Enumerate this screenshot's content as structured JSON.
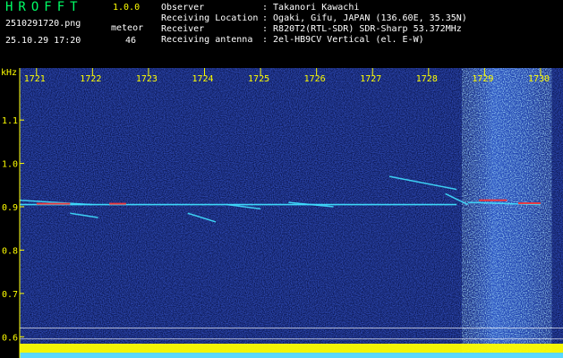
{
  "header": {
    "logo": "HROFFT",
    "version": "1.0.0",
    "filename": "2510291720.png",
    "datetime": "25.10.29 17:20",
    "meteor_label": "meteor",
    "meteor_count": "46",
    "info": [
      {
        "label": "Observer",
        "value": ": Takanori Kawachi"
      },
      {
        "label": "Receiving Location",
        "value": ": Ogaki, Gifu, JAPAN (136.60E, 35.35N)"
      },
      {
        "label": "Receiver",
        "value": ": R820T2(RTL-SDR) SDR-Sharp 53.372MHz"
      },
      {
        "label": "Receiving antenna",
        "value": ": 2el-HB9CV Vertical (el. E-W)"
      }
    ]
  },
  "colors": {
    "background_noise": "#0a1a6e",
    "signal_cyan": "#40e0ff",
    "signal_red": "#ff3030",
    "label_yellow": "#ffff00",
    "header_green": "#00ff66",
    "amplitude_bar": "#ffff00"
  },
  "chart_data": {
    "type": "heatmap",
    "ylabel": "kHz",
    "xlim": [
      1720.7,
      1730.4
    ],
    "ylim": [
      0.58,
      1.22
    ],
    "x_ticks": [
      "1721",
      "1722",
      "1723",
      "1724",
      "1725",
      "1726",
      "1727",
      "1728",
      "1729",
      "1730"
    ],
    "y_ticks": [
      "1.1",
      "1.0",
      "0.9",
      "0.8",
      "0.7",
      "0.6"
    ],
    "y_tick_values": [
      1.1,
      1.0,
      0.9,
      0.8,
      0.7,
      0.6
    ],
    "continuous_carrier": {
      "y": 0.905,
      "x": [
        1720.7,
        1728.5
      ]
    },
    "meteor_echoes": [
      {
        "x": [
          1720.7,
          1722.0
        ],
        "y": [
          0.915,
          0.905
        ]
      },
      {
        "x": [
          1721.6,
          1722.1
        ],
        "y": [
          0.885,
          0.875
        ]
      },
      {
        "x": [
          1723.7,
          1724.2
        ],
        "y": [
          0.885,
          0.865
        ]
      },
      {
        "x": [
          1724.4,
          1725.0
        ],
        "y": [
          0.905,
          0.895
        ]
      },
      {
        "x": [
          1725.5,
          1726.3
        ],
        "y": [
          0.91,
          0.9
        ]
      },
      {
        "x": [
          1727.3,
          1728.5
        ],
        "y": [
          0.97,
          0.94
        ]
      },
      {
        "x": [
          1728.3,
          1728.7
        ],
        "y": [
          0.93,
          0.905
        ]
      },
      {
        "x": [
          1728.7,
          1730.0
        ],
        "y": [
          0.91,
          0.905
        ]
      }
    ],
    "strong_echoes": [
      {
        "x": [
          1721.0,
          1721.6
        ],
        "y": 0.907
      },
      {
        "x": [
          1722.3,
          1722.6
        ],
        "y": 0.907
      },
      {
        "x": [
          1728.9,
          1729.4
        ],
        "y": 0.915
      },
      {
        "x": [
          1729.6,
          1730.0
        ],
        "y": 0.908
      }
    ],
    "noise_burst": {
      "x": [
        1728.6,
        1730.2
      ]
    },
    "reference_lines": [
      0.62,
      0.595
    ]
  }
}
